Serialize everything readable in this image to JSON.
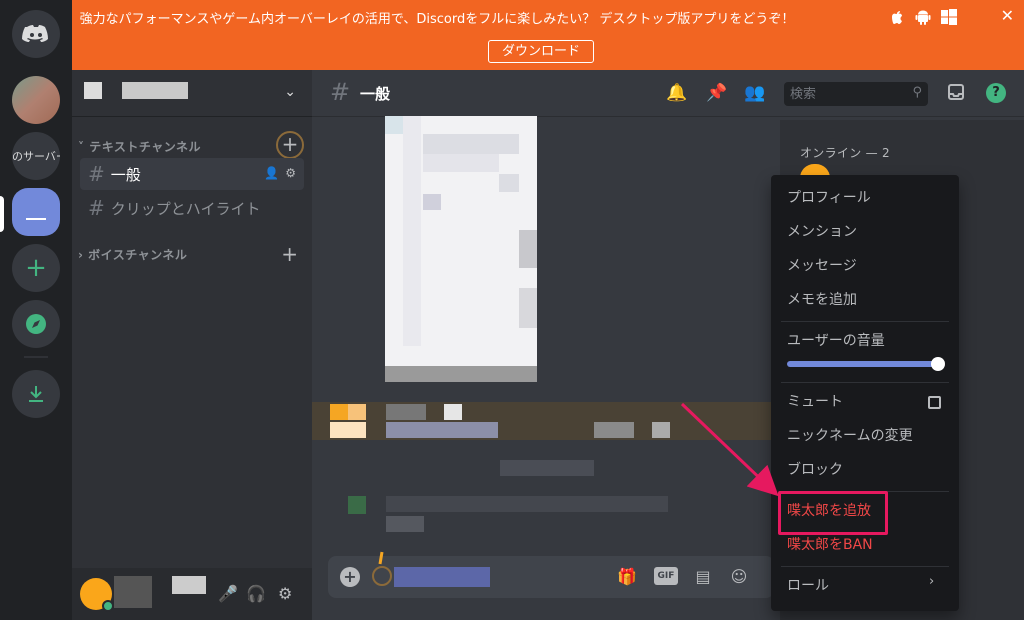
{
  "banner": {
    "text": "強力なパフォーマンスやゲーム内オーバーレイの活用で、Discordをフルに楽しみたい？ デスクトップ版アプリをどうぞ！",
    "download_label": "ダウンロード",
    "close_glyph": "✕"
  },
  "rail": {
    "server_text": "のサーバー",
    "add_glyph": "+"
  },
  "sidebar": {
    "text_category": "テキストチャンネル",
    "voice_category": "ボイスチャンネル",
    "channels": [
      {
        "name": "一般",
        "active": true
      },
      {
        "name": "クリップとハイライト",
        "active": false
      }
    ]
  },
  "chat": {
    "channel_name": "一般",
    "search_placeholder": "検索",
    "gif_label": "GIF"
  },
  "members": {
    "online_label": "オンライン — 2"
  },
  "context_menu": {
    "items": [
      "プロフィール",
      "メンション",
      "メッセージ",
      "メモを追加"
    ],
    "volume_label": "ユーザーの音量",
    "volume_level": 0.95,
    "mute_label": "ミュート",
    "nickname_label": "ニックネームの変更",
    "block_label": "ブロック",
    "add_bot_label": "喋太郎を追放",
    "ban_label": "喋太郎をBAN",
    "role_label": "ロール"
  },
  "colors": {
    "banner": "#f26522",
    "accent": "#7289da",
    "danger": "#f04747",
    "highlight": "#e6195f",
    "online": "#43b581"
  }
}
